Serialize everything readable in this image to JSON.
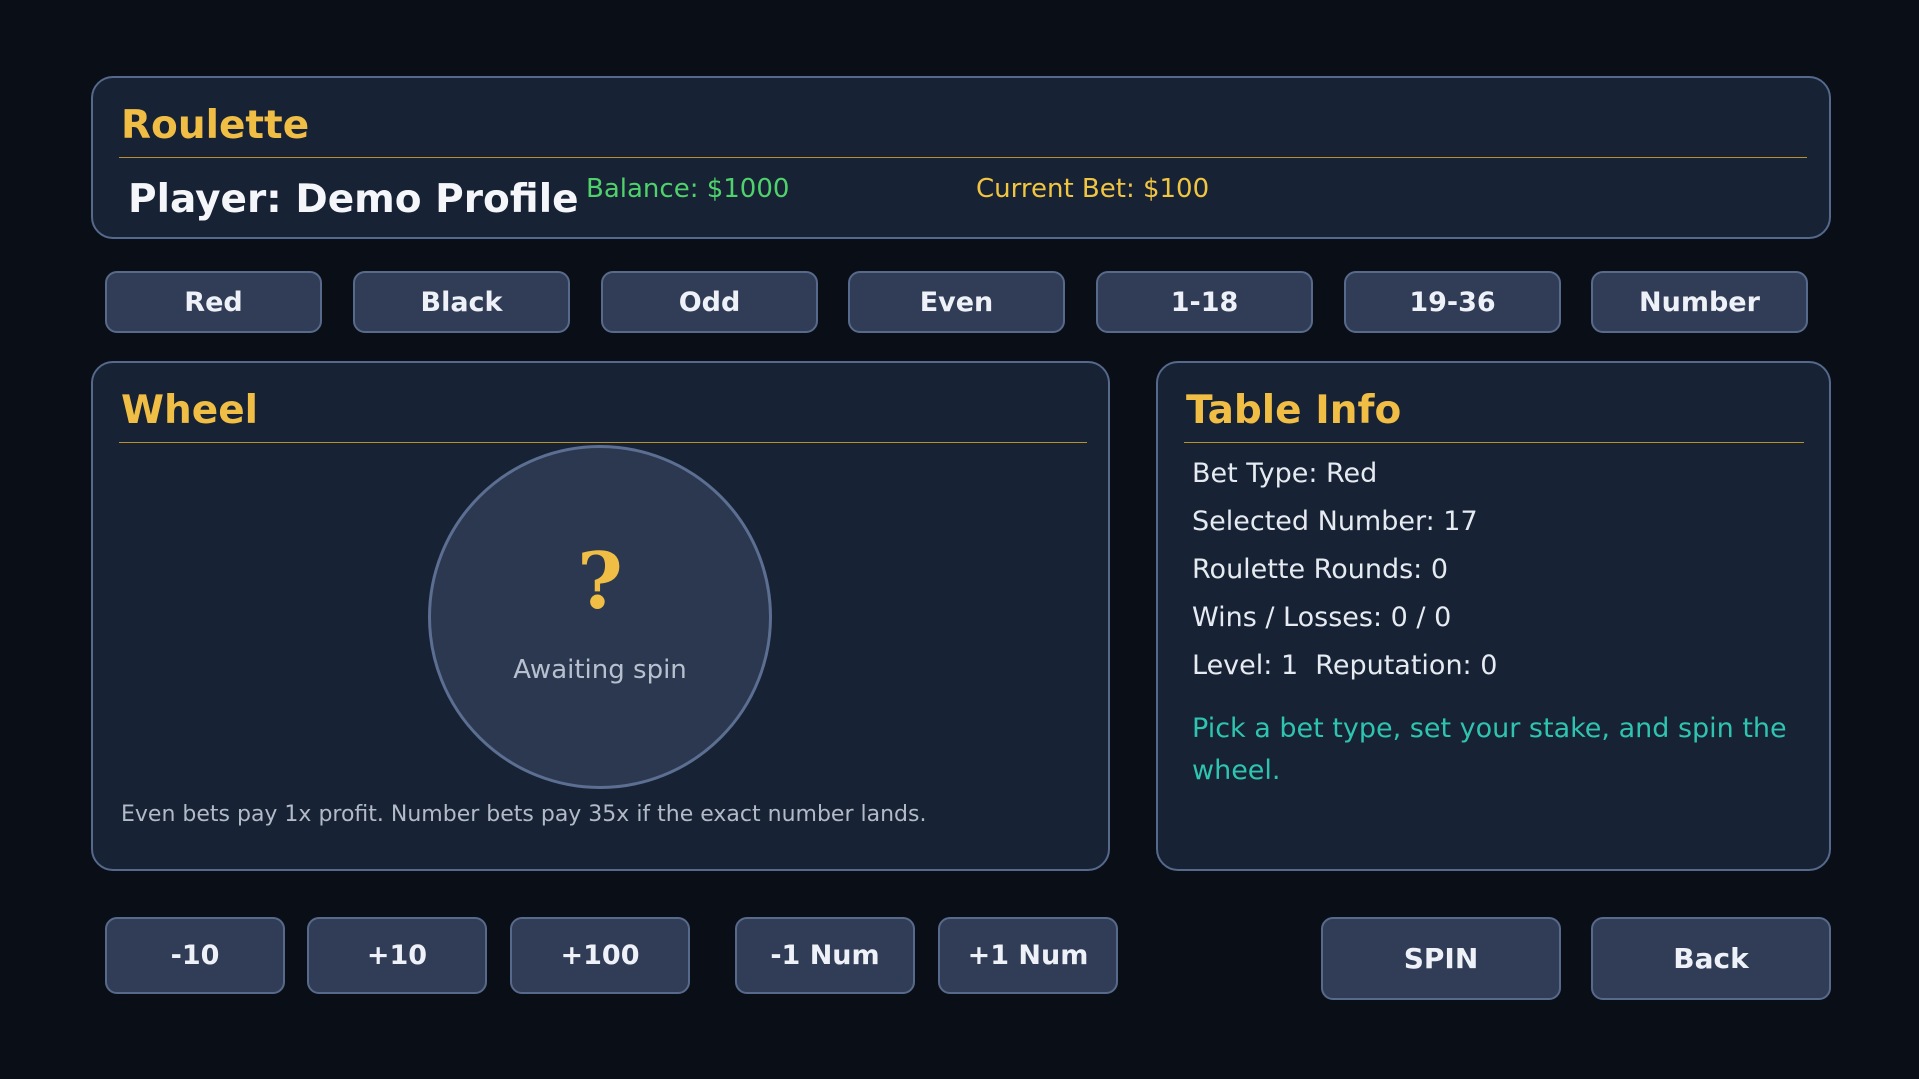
{
  "header": {
    "title": "Roulette",
    "player": "Player: Demo Profile",
    "balance": "Balance: $1000",
    "current_bet": "Current Bet: $100"
  },
  "bet_types": [
    "Red",
    "Black",
    "Odd",
    "Even",
    "1-18",
    "19-36",
    "Number"
  ],
  "wheel": {
    "title": "Wheel",
    "symbol": "?",
    "status": "Awaiting spin",
    "note": "Even bets pay 1x profit. Number bets pay 35x if the exact number lands."
  },
  "table_info": {
    "title": "Table Info",
    "bet_type": "Bet Type: Red",
    "selected_number": "Selected Number: 17",
    "rounds": "Roulette Rounds: 0",
    "wins_losses": "Wins / Losses: 0 / 0",
    "level_rep": "Level: 1  Reputation: 0",
    "message": "Pick a bet type, set your stake, and spin the wheel."
  },
  "controls": {
    "minus10": "-10",
    "plus10": "+10",
    "plus100": "+100",
    "minus_num": "-1 Num",
    "plus_num": "+1 Num",
    "spin": "SPIN",
    "back": "Back"
  },
  "colors": {
    "accent": "#f0bd45",
    "balance": "#4fd16b",
    "current_bet": "#f0c542",
    "message": "#2ec4b0"
  }
}
